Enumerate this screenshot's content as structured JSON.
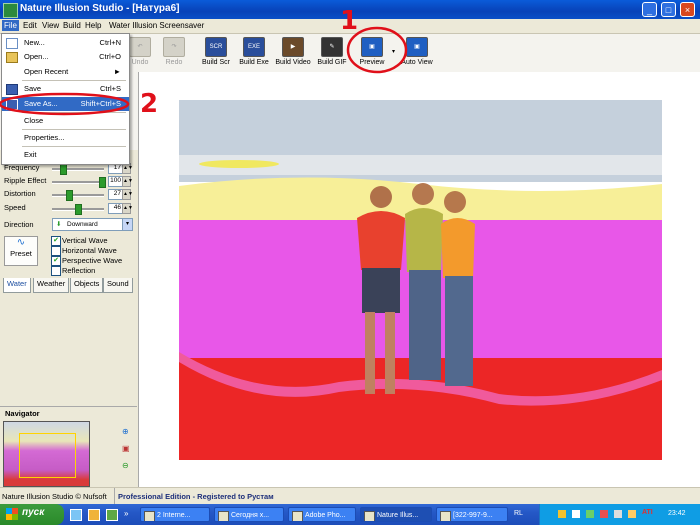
{
  "window": {
    "title": "Nature Illusion Studio - [Натура6]",
    "controls": [
      "_",
      "□",
      "×"
    ]
  },
  "menubar": {
    "items": [
      "File",
      "Edit",
      "View",
      "Build",
      "Help",
      "Water Illusion Screensaver"
    ]
  },
  "toolbar": {
    "items": [
      {
        "label": "Undo",
        "icon": "undo-icon",
        "disabled": true
      },
      {
        "label": "Redo",
        "icon": "redo-icon",
        "disabled": true
      },
      {
        "label": "Build Scr",
        "icon": "scr-icon",
        "badge": "SCR"
      },
      {
        "label": "Build Exe",
        "icon": "exe-icon",
        "badge": "EXE"
      },
      {
        "label": "Build Video",
        "icon": "video-icon",
        "badge": ""
      },
      {
        "label": "Build GIF",
        "icon": "gif-icon",
        "badge": ""
      },
      {
        "label": "Preview",
        "icon": "preview-icon",
        "badge": ""
      },
      {
        "label": "Auto View",
        "icon": "autoview-icon",
        "badge": ""
      }
    ]
  },
  "file_menu": {
    "items": [
      {
        "label": "New...",
        "shortcut": "Ctrl+N",
        "icon": "new-icon"
      },
      {
        "label": "Open...",
        "shortcut": "Ctrl+O",
        "icon": "open-icon"
      },
      {
        "label": "Open Recent",
        "shortcut": "",
        "submenu": "►"
      },
      {
        "label": "Save",
        "shortcut": "Ctrl+S",
        "icon": "save-icon"
      },
      {
        "label": "Save As...",
        "shortcut": "Shift+Ctrl+S",
        "icon": "save-as-icon",
        "highlighted": true
      },
      {
        "label": "Close",
        "shortcut": ""
      },
      {
        "label": "Properties...",
        "shortcut": ""
      },
      {
        "label": "Exit",
        "shortcut": ""
      }
    ]
  },
  "water_panel": {
    "params": [
      {
        "label": "Frequency",
        "value": "17",
        "level": 0.15
      },
      {
        "label": "Ripple Effect",
        "value": "100",
        "level": 1.0
      },
      {
        "label": "Distortion",
        "value": "27",
        "level": 0.27
      },
      {
        "label": "Speed",
        "value": "46",
        "level": 0.46
      }
    ],
    "direction_label": "Direction",
    "direction_value": "Downward",
    "preset_label": "Preset",
    "checkboxes": [
      {
        "label": "Vertical Wave",
        "checked": true
      },
      {
        "label": "Horizontal Wave",
        "checked": false
      },
      {
        "label": "Perspective Wave",
        "checked": true
      },
      {
        "label": "Reflection",
        "checked": false
      }
    ],
    "tabs": [
      "Water",
      "Weather",
      "Objects",
      "Sound"
    ],
    "active_tab": "Water"
  },
  "navigator": {
    "title": "Navigator"
  },
  "status": {
    "left": "Nature Illusion Studio © Nufsoft",
    "right": "Professional Edition - Registered to Рустам"
  },
  "taskbar": {
    "start_label": "пуск",
    "tasks": [
      "2 Interne...",
      "Сегодня х...",
      "Adobe Pho...",
      "Nature Illus...",
      "[322-997-9..."
    ],
    "active_task": "Nature Illus...",
    "lang": "RL",
    "clock": "23:42"
  },
  "annotations": {
    "one": "1",
    "two": "2"
  },
  "colors": {
    "highlight": "#316ac5",
    "annotation": "#e0101a",
    "title_bar": "#0842b8"
  }
}
